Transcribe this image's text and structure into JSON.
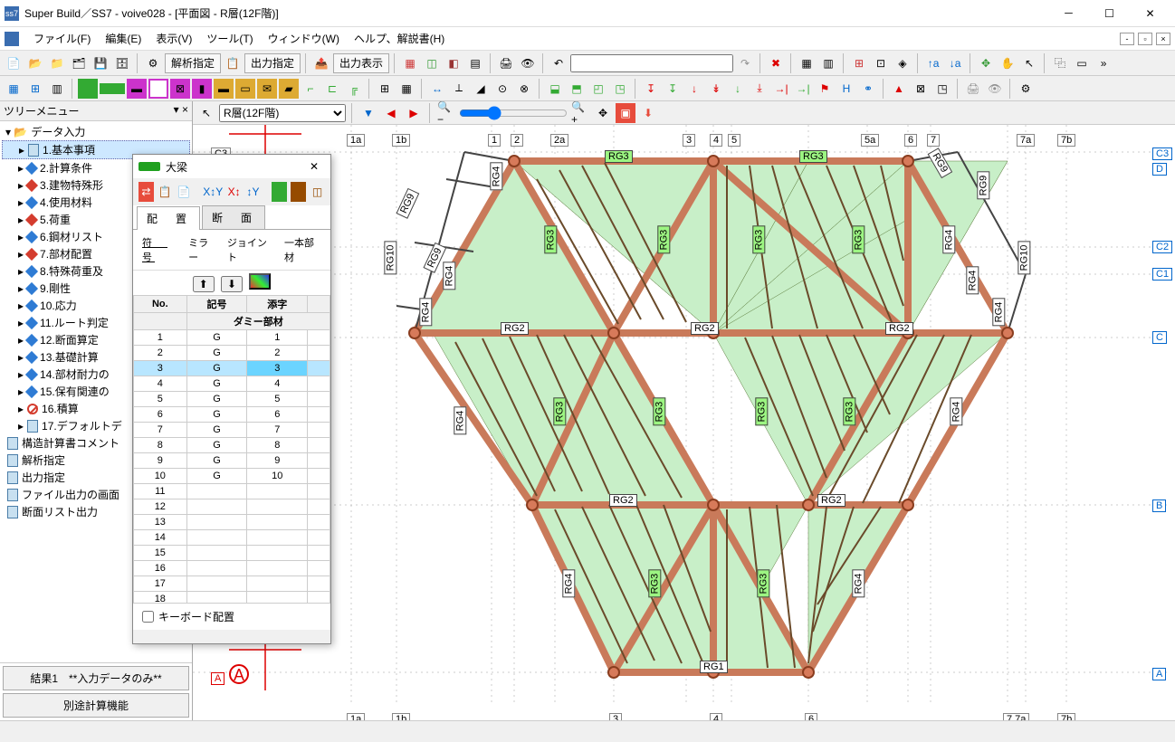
{
  "window": {
    "title": "Super Build／SS7 - voive028 - [平面図 - R層(12F階)]",
    "min": "－",
    "max": "☐",
    "close": "✕"
  },
  "menu": [
    "ファイル(F)",
    "編集(E)",
    "表示(V)",
    "ツール(T)",
    "ウィンドウ(W)",
    "ヘルプ、解説書(H)"
  ],
  "toolbar_text": {
    "analysis": "解析指定",
    "output": "出力指定",
    "output_show": "出力表示"
  },
  "tree": {
    "header": "ツリーメニュー",
    "root": "データ入力",
    "items": [
      {
        "label": "1.基本事項",
        "sel": true,
        "icon": "doc"
      },
      {
        "label": "2.計算条件",
        "icon": "blue"
      },
      {
        "label": "3.建物特殊形",
        "icon": "red"
      },
      {
        "label": "4.使用材料",
        "icon": "blue"
      },
      {
        "label": "5.荷重",
        "icon": "red"
      },
      {
        "label": "6.鋼材リスト",
        "icon": "blue"
      },
      {
        "label": "7.部材配置",
        "icon": "red"
      },
      {
        "label": "8.特殊荷重及",
        "icon": "blue"
      },
      {
        "label": "9.剛性",
        "icon": "blue"
      },
      {
        "label": "10.応力",
        "icon": "blue"
      },
      {
        "label": "11.ルート判定",
        "icon": "blue"
      },
      {
        "label": "12.断面算定",
        "icon": "blue"
      },
      {
        "label": "13.基礎計算",
        "icon": "blue"
      },
      {
        "label": "14.部材耐力の",
        "icon": "blue"
      },
      {
        "label": "15.保有関連の",
        "icon": "blue"
      },
      {
        "label": "16.積算",
        "icon": "nocircle"
      },
      {
        "label": "17.デフォルトデ",
        "icon": "doc"
      }
    ],
    "bottom": [
      "構造計算書コメント",
      "解析指定",
      "出力指定",
      "ファイル出力の画面",
      "断面リスト出力"
    ],
    "foot": {
      "result": "結果1　**入力データのみ**",
      "other": "別途計算機能"
    }
  },
  "canvas": {
    "layer": "R層(12F階)"
  },
  "axis_top": [
    "1a",
    "1b",
    "1",
    "2",
    "2a",
    "3",
    "4",
    "5",
    "5a",
    "6",
    "7",
    "7a",
    "7b"
  ],
  "axis_bottom": [
    "1a",
    "1b",
    "3",
    "4",
    "6",
    "7 7a",
    "7b"
  ],
  "axis_left": [
    "C3",
    "A",
    "A"
  ],
  "axis_right": [
    "C3",
    "D",
    "C2",
    "C1",
    "C",
    "B",
    "A"
  ],
  "beam_labels_green": [
    "RG3",
    "RG3",
    "RG3",
    "RG3",
    "RG3",
    "RG3",
    "RG3",
    "RG3",
    "RG3",
    "RG3",
    "RG3",
    "RG3"
  ],
  "beam_labels_plain": [
    "RG2",
    "RG2",
    "RG2",
    "RG2",
    "RG2",
    "RG1",
    "RG4",
    "RG4",
    "RG4",
    "RG4",
    "RG4",
    "RG4",
    "RG4",
    "RG4",
    "RG9",
    "RG9",
    "RG9",
    "RG9",
    "RG10",
    "RG10",
    "RG4",
    "RG4"
  ],
  "float": {
    "title": "大梁",
    "tabs": [
      "配　置",
      "断　面"
    ],
    "subtabs": [
      "符　号",
      "ミラー",
      "ジョイント",
      "一本部材"
    ],
    "cols": [
      "No.",
      "記号",
      "添字",
      ""
    ],
    "dummy": "ダミー部材",
    "rows": [
      {
        "n": 1,
        "s": "G",
        "i": "1"
      },
      {
        "n": 2,
        "s": "G",
        "i": "2"
      },
      {
        "n": 3,
        "s": "G",
        "i": "3",
        "sel": true
      },
      {
        "n": 4,
        "s": "G",
        "i": "4"
      },
      {
        "n": 5,
        "s": "G",
        "i": "5"
      },
      {
        "n": 6,
        "s": "G",
        "i": "6"
      },
      {
        "n": 7,
        "s": "G",
        "i": "7"
      },
      {
        "n": 8,
        "s": "G",
        "i": "8"
      },
      {
        "n": 9,
        "s": "G",
        "i": "9"
      },
      {
        "n": 10,
        "s": "G",
        "i": "10"
      },
      {
        "n": 11
      },
      {
        "n": 12
      },
      {
        "n": 13
      },
      {
        "n": 14
      },
      {
        "n": 15
      },
      {
        "n": 16
      },
      {
        "n": 17
      },
      {
        "n": 18
      }
    ],
    "foot_check": "キーボード配置"
  }
}
